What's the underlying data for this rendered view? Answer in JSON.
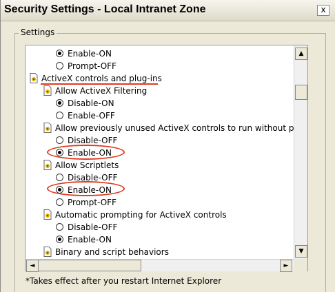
{
  "window": {
    "title": "Security Settings - Local Intranet Zone",
    "close_label": "x"
  },
  "settings": {
    "group_label": "Settings",
    "items": [
      {
        "kind": "radio",
        "label": "Enable-ON",
        "checked": true
      },
      {
        "kind": "radio",
        "label": "Prompt-OFF",
        "checked": false
      },
      {
        "kind": "category",
        "label": "ActiveX controls and plug-ins"
      },
      {
        "kind": "setting",
        "label": "Allow ActiveX Filtering"
      },
      {
        "kind": "radio",
        "label": "Disable-ON",
        "checked": true
      },
      {
        "kind": "radio",
        "label": "Enable-OFF",
        "checked": false
      },
      {
        "kind": "setting",
        "label": "Allow previously unused ActiveX controls to run without prom"
      },
      {
        "kind": "radio",
        "label": "Disable-OFF",
        "checked": false
      },
      {
        "kind": "radio",
        "label": "Enable-ON",
        "checked": true
      },
      {
        "kind": "setting",
        "label": "Allow Scriptlets"
      },
      {
        "kind": "radio",
        "label": "Disable-OFF",
        "checked": false
      },
      {
        "kind": "radio",
        "label": "Enable-ON",
        "checked": true
      },
      {
        "kind": "radio",
        "label": "Prompt-OFF",
        "checked": false
      },
      {
        "kind": "setting",
        "label": "Automatic prompting for ActiveX controls"
      },
      {
        "kind": "radio",
        "label": "Disable-OFF",
        "checked": false
      },
      {
        "kind": "radio",
        "label": "Enable-ON",
        "checked": true
      },
      {
        "kind": "setting",
        "label": "Binary and script behaviors"
      }
    ]
  },
  "scrollbars": {
    "up": "▲",
    "down": "▼",
    "left": "◄",
    "right": "►"
  },
  "footnote": "*Takes effect after you restart Internet Explorer",
  "colors": {
    "annotation": "#e03a1e",
    "list_border": "#7f9db9"
  }
}
